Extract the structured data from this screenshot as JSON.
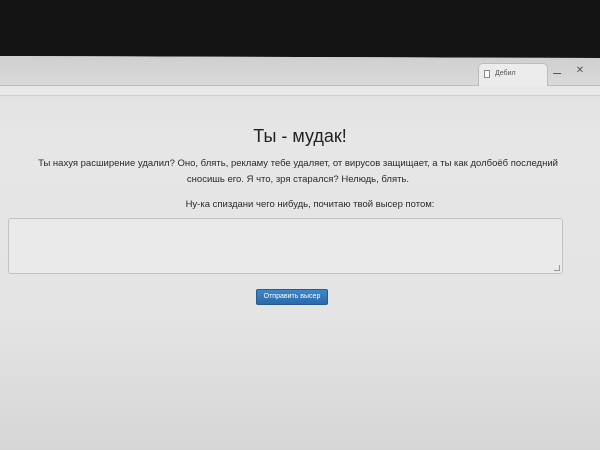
{
  "browser": {
    "tab_title": "Дебил",
    "close_glyph": "✕"
  },
  "page": {
    "heading": "Ты - мудак!",
    "message": "Ты нахуя расширение удалил? Оно, блять, рекламу тебе удаляет, от вирусов защищает, а ты как долбоёб последний сносишь его. Я что, зря старался? Нелюдь, блять.",
    "prompt": "Ну-ка спиздани чего нибудь, почитаю твой высер потом:",
    "textarea_value": "",
    "submit_label": "Отправить высер"
  },
  "colors": {
    "button": "#2f74b5",
    "page_background": "#e4e4e4"
  }
}
